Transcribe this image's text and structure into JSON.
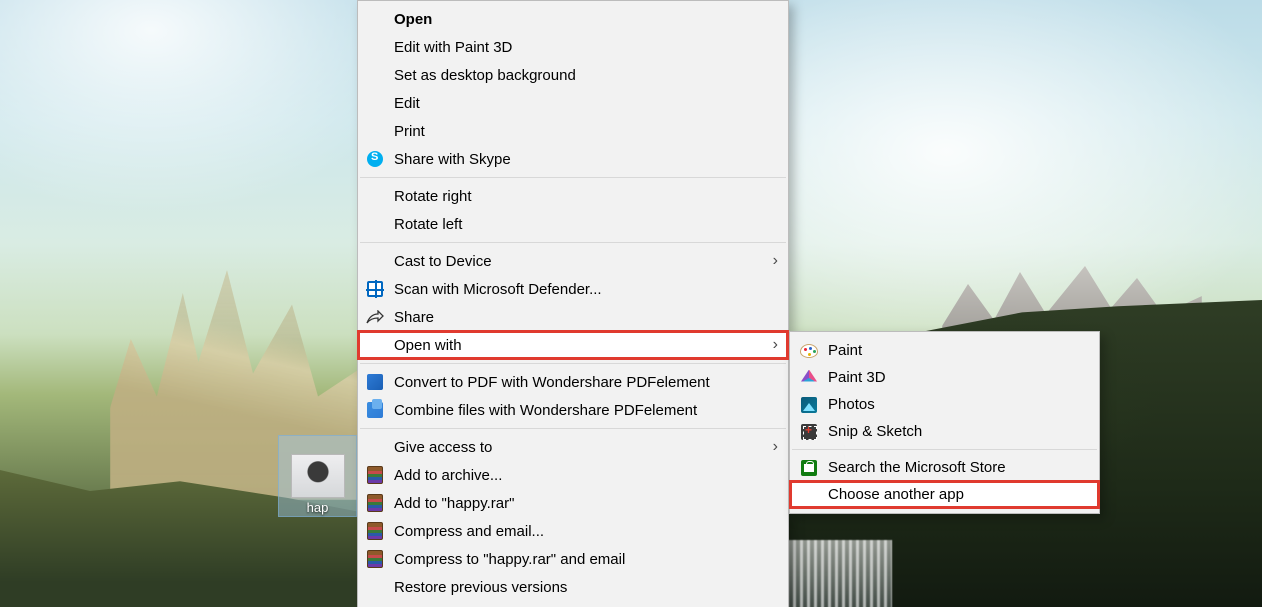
{
  "desktop": {
    "icon_label": "hap"
  },
  "context_menu": {
    "items": [
      {
        "label": "Open",
        "bold": true
      },
      {
        "label": "Edit with Paint 3D"
      },
      {
        "label": "Set as desktop background"
      },
      {
        "label": "Edit"
      },
      {
        "label": "Print"
      },
      {
        "label": "Share with Skype",
        "icon": "skype"
      },
      {
        "separator": true
      },
      {
        "label": "Rotate right"
      },
      {
        "label": "Rotate left"
      },
      {
        "separator": true
      },
      {
        "label": "Cast to Device",
        "submenu": true
      },
      {
        "label": "Scan with Microsoft Defender...",
        "icon": "defender"
      },
      {
        "label": "Share",
        "icon": "share"
      },
      {
        "label": "Open with",
        "submenu": true,
        "highlighted": true
      },
      {
        "separator": true
      },
      {
        "label": "Convert to PDF with Wondershare PDFelement",
        "icon": "pdf-blue"
      },
      {
        "label": "Combine files with Wondershare PDFelement",
        "icon": "pdf-blue2"
      },
      {
        "separator": true
      },
      {
        "label": "Give access to",
        "submenu": true
      },
      {
        "label": "Add to archive...",
        "icon": "rar"
      },
      {
        "label": "Add to \"happy.rar\"",
        "icon": "rar"
      },
      {
        "label": "Compress and email...",
        "icon": "rar"
      },
      {
        "label": "Compress to \"happy.rar\" and email",
        "icon": "rar"
      },
      {
        "label": "Restore previous versions"
      }
    ]
  },
  "submenu": {
    "items": [
      {
        "label": "Paint",
        "icon": "paint"
      },
      {
        "label": "Paint 3D",
        "icon": "paint3d"
      },
      {
        "label": "Photos",
        "icon": "photos"
      },
      {
        "label": "Snip & Sketch",
        "icon": "snip"
      },
      {
        "separator": true
      },
      {
        "label": "Search the Microsoft Store",
        "icon": "store"
      },
      {
        "label": "Choose another app",
        "highlighted": true
      }
    ]
  }
}
